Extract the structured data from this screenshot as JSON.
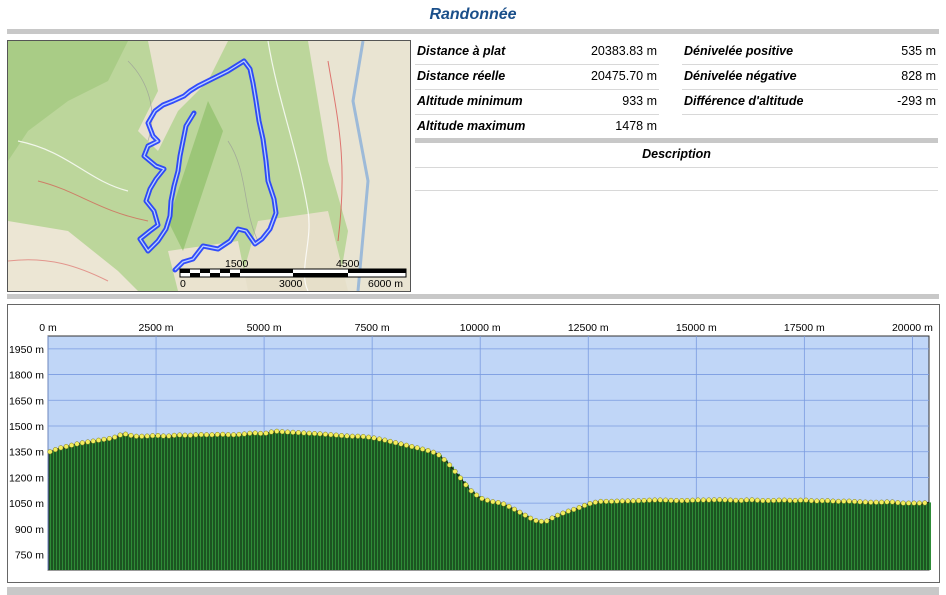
{
  "title": "Randonnée",
  "stats": {
    "left": [
      {
        "label": "Distance à plat",
        "value": "20383.83 m"
      },
      {
        "label": "Distance réelle",
        "value": "20475.70 m"
      },
      {
        "label": "Altitude minimum",
        "value": "933 m"
      },
      {
        "label": "Altitude maximum",
        "value": "1478 m"
      }
    ],
    "right": [
      {
        "label": "Dénivelée positive",
        "value": "535 m"
      },
      {
        "label": "Dénivelée négative",
        "value": "828 m"
      },
      {
        "label": "Différence d'altitude",
        "value": "-293 m"
      }
    ]
  },
  "description": {
    "title": "Description"
  },
  "map": {
    "scale_top_labels": [
      "1500",
      "4500"
    ],
    "scale_bottom_labels": [
      "0",
      "3000",
      "6000 m"
    ],
    "route_color": "#1e3cff"
  },
  "colors": {
    "sky": "#c0d6f7",
    "fill": "#2e8b37",
    "marker": "#f2ee5e",
    "grid": "#7a9be0"
  },
  "chart_data": {
    "type": "area",
    "x_tick_labels": [
      "0 m",
      "2500 m",
      "5000 m",
      "7500 m",
      "10000 m",
      "12500 m",
      "15000 m",
      "17500 m",
      "20000 m"
    ],
    "y_tick_labels": [
      "1950 m",
      "1800 m",
      "1650 m",
      "1500 m",
      "1350 m",
      "1200 m",
      "1050 m",
      "900 m",
      "750 m"
    ],
    "xlim": [
      0,
      20384
    ],
    "ylim": [
      660,
      2025
    ],
    "x": [
      0,
      250,
      500,
      750,
      1000,
      1250,
      1500,
      1750,
      2000,
      2250,
      2500,
      2750,
      3000,
      3250,
      3500,
      3750,
      4000,
      4250,
      4500,
      4750,
      5000,
      5250,
      5500,
      5750,
      6000,
      6250,
      6500,
      6750,
      7000,
      7250,
      7500,
      7750,
      8000,
      8250,
      8500,
      8750,
      9000,
      9250,
      9500,
      9750,
      10000,
      10250,
      10500,
      10750,
      11000,
      11250,
      11500,
      11750,
      12000,
      12250,
      12500,
      12750,
      13000,
      13250,
      13500,
      13750,
      14000,
      14250,
      14500,
      14750,
      15000,
      15250,
      15500,
      15750,
      16000,
      16250,
      16500,
      16750,
      17000,
      17250,
      17500,
      17750,
      18000,
      18250,
      18500,
      18750,
      19000,
      19250,
      19500,
      19750,
      20000,
      20250,
      20384
    ],
    "y": [
      1345,
      1370,
      1385,
      1400,
      1410,
      1420,
      1430,
      1455,
      1440,
      1440,
      1445,
      1440,
      1448,
      1445,
      1450,
      1448,
      1452,
      1448,
      1452,
      1460,
      1455,
      1470,
      1465,
      1462,
      1458,
      1455,
      1450,
      1445,
      1440,
      1440,
      1432,
      1420,
      1405,
      1390,
      1375,
      1360,
      1340,
      1285,
      1210,
      1130,
      1080,
      1060,
      1050,
      1020,
      985,
      950,
      940,
      975,
      1000,
      1020,
      1045,
      1060,
      1060,
      1062,
      1063,
      1065,
      1068,
      1068,
      1065,
      1065,
      1068,
      1068,
      1070,
      1068,
      1065,
      1070,
      1065,
      1065,
      1068,
      1065,
      1068,
      1062,
      1065,
      1060,
      1062,
      1058,
      1055,
      1055,
      1058,
      1050,
      1050,
      1050,
      1055
    ]
  }
}
